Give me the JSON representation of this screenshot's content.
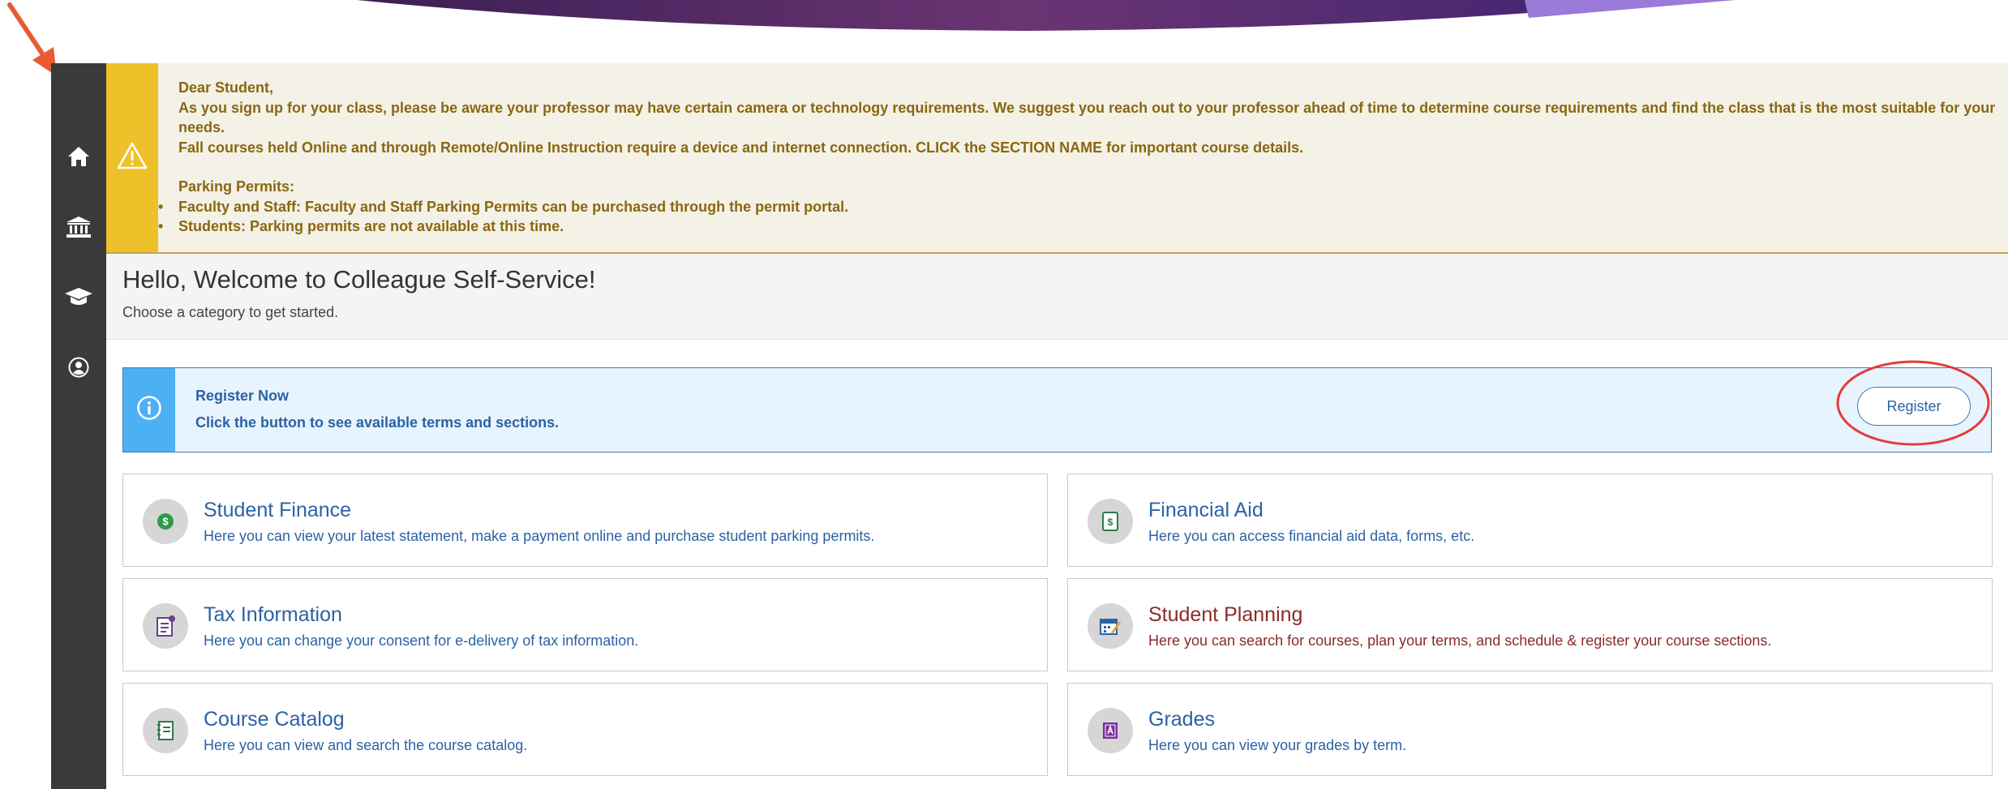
{
  "colors": {
    "sidebar": "#3a3a3a",
    "alert_strip": "#eec12a",
    "alert_text": "#8a6712",
    "info_strip": "#4db0f4",
    "link_blue": "#2b62a4",
    "planning_red": "#8b2b2b"
  },
  "sidebar": {
    "items": [
      {
        "icon": "home-icon"
      },
      {
        "icon": "bank-icon"
      },
      {
        "icon": "graduation-cap-icon"
      },
      {
        "icon": "user-profile-icon"
      }
    ]
  },
  "alert": {
    "icon": "warning-icon",
    "greeting": "Dear Student,",
    "line1": "As you sign up for your class, please be aware your professor may have certain camera or technology requirements. We suggest you reach out to your professor ahead of time to determine course requirements and find the class that is the most suitable for your needs.",
    "line2": "Fall courses held Online and through Remote/Online Instruction require a device and internet connection. CLICK the SECTION NAME for important course details.",
    "parking_heading": "Parking Permits:",
    "bullets": [
      "Faculty and Staff: Faculty and Staff Parking Permits can be purchased through the permit portal.",
      "Students: Parking permits are not available at this time."
    ]
  },
  "welcome": {
    "title": "Hello, Welcome to Colleague Self-Service!",
    "subtitle": "Choose a category to get started."
  },
  "register": {
    "icon": "info-icon",
    "title": "Register Now",
    "description": "Click the button to see available terms and sections.",
    "button_label": "Register"
  },
  "tiles": [
    {
      "icon": "dollar-icon",
      "title": "Student Finance",
      "description": "Here you can view your latest statement, make a payment online and purchase student parking permits."
    },
    {
      "icon": "financial-aid-icon",
      "title": "Financial Aid",
      "description": "Here you can access financial aid data, forms, etc."
    },
    {
      "icon": "tax-document-icon",
      "title": "Tax Information",
      "description": "Here you can change your consent for e-delivery of tax information."
    },
    {
      "icon": "calendar-planning-icon",
      "title": "Student Planning",
      "description": "Here you can search for courses, plan your terms, and schedule & register your course sections."
    },
    {
      "icon": "catalog-book-icon",
      "title": "Course Catalog",
      "description": "Here you can view and search the course catalog."
    },
    {
      "icon": "grades-icon",
      "title": "Grades",
      "description": "Here you can view your grades by term."
    }
  ]
}
